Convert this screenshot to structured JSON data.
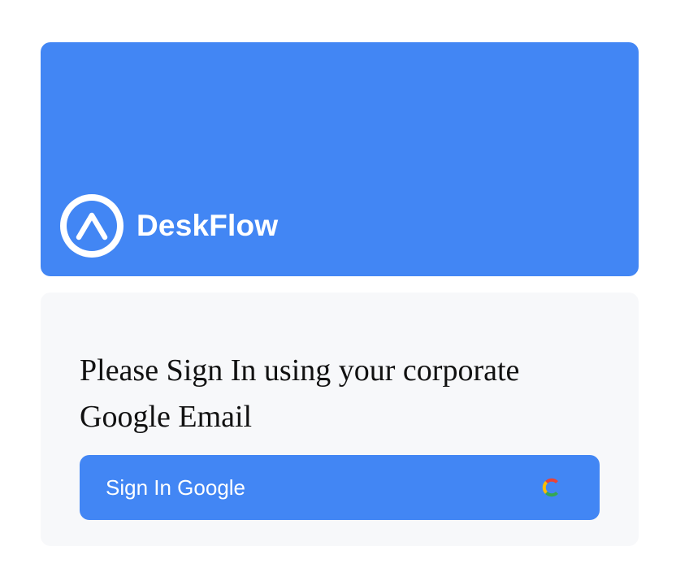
{
  "brand": {
    "name": "DeskFlow",
    "logo_icon": "deskflow-logo-icon",
    "background_color": "#4286f4"
  },
  "signin": {
    "message": "Please Sign In using your corporate Google Email",
    "button_label": "Sign In Google",
    "button_icon": "google-icon",
    "button_color": "#4286f4",
    "panel_color": "#f7f8fa"
  }
}
